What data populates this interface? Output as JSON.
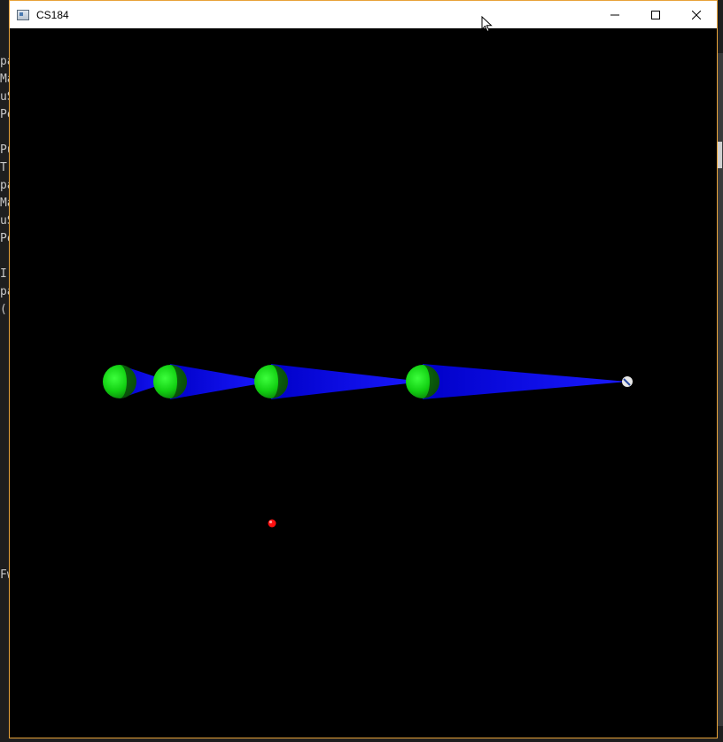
{
  "window": {
    "title": "CS184",
    "minimize_label": "—",
    "maximize_label": "☐",
    "close_label": "✕"
  },
  "icons": {
    "app": "app-window-icon",
    "cursor": "mouse-pointer-icon"
  },
  "background_editor": {
    "left_fragments": [
      "pa",
      "Ma",
      "uS",
      "Po",
      "",
      "Pu",
      "Tr",
      "pa",
      "Ma",
      "uS",
      "Po",
      "",
      "I",
      "pa",
      "(",
      "",
      "",
      "",
      "",
      "",
      "",
      "",
      "",
      "",
      "",
      "",
      "",
      "",
      "",
      "Fw"
    ]
  },
  "scene": {
    "sphere_color": "#18e018",
    "sphere_shadow": "#0a5a0a",
    "cone_color": "#1010ff",
    "target_color": "#ff1010",
    "light_color": "#ffffff"
  }
}
